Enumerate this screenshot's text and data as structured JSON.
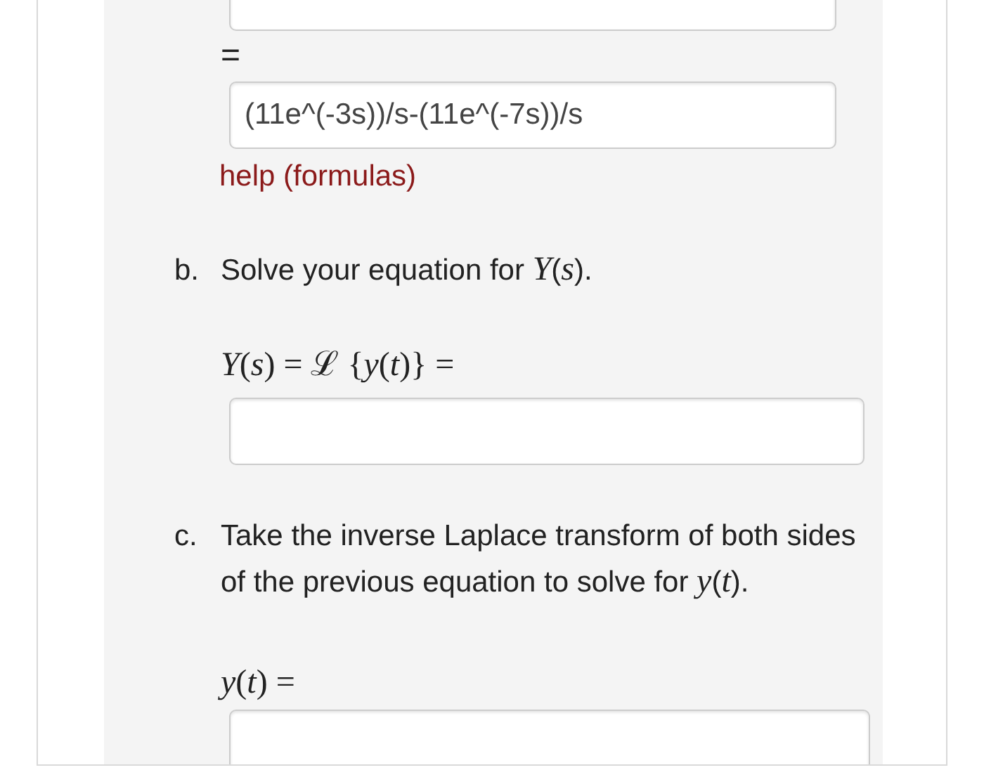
{
  "part_a": {
    "equals": "=",
    "answer": {
      "value": "(11e^(-3s))/s-(11e^(-7s))/s"
    },
    "help_link": "help (formulas)"
  },
  "part_b": {
    "marker": "b.",
    "prompt": "Solve your equation for *Y*(*s*).",
    "equation": "*Y*(*s*) = ℒ {*y*(*t*)} ="
  },
  "part_c": {
    "marker": "c.",
    "prompt": "Take the inverse Laplace transform of both sides of the previous equation to solve for *y*(*t*).",
    "equation": "*y*(*t*) ="
  }
}
